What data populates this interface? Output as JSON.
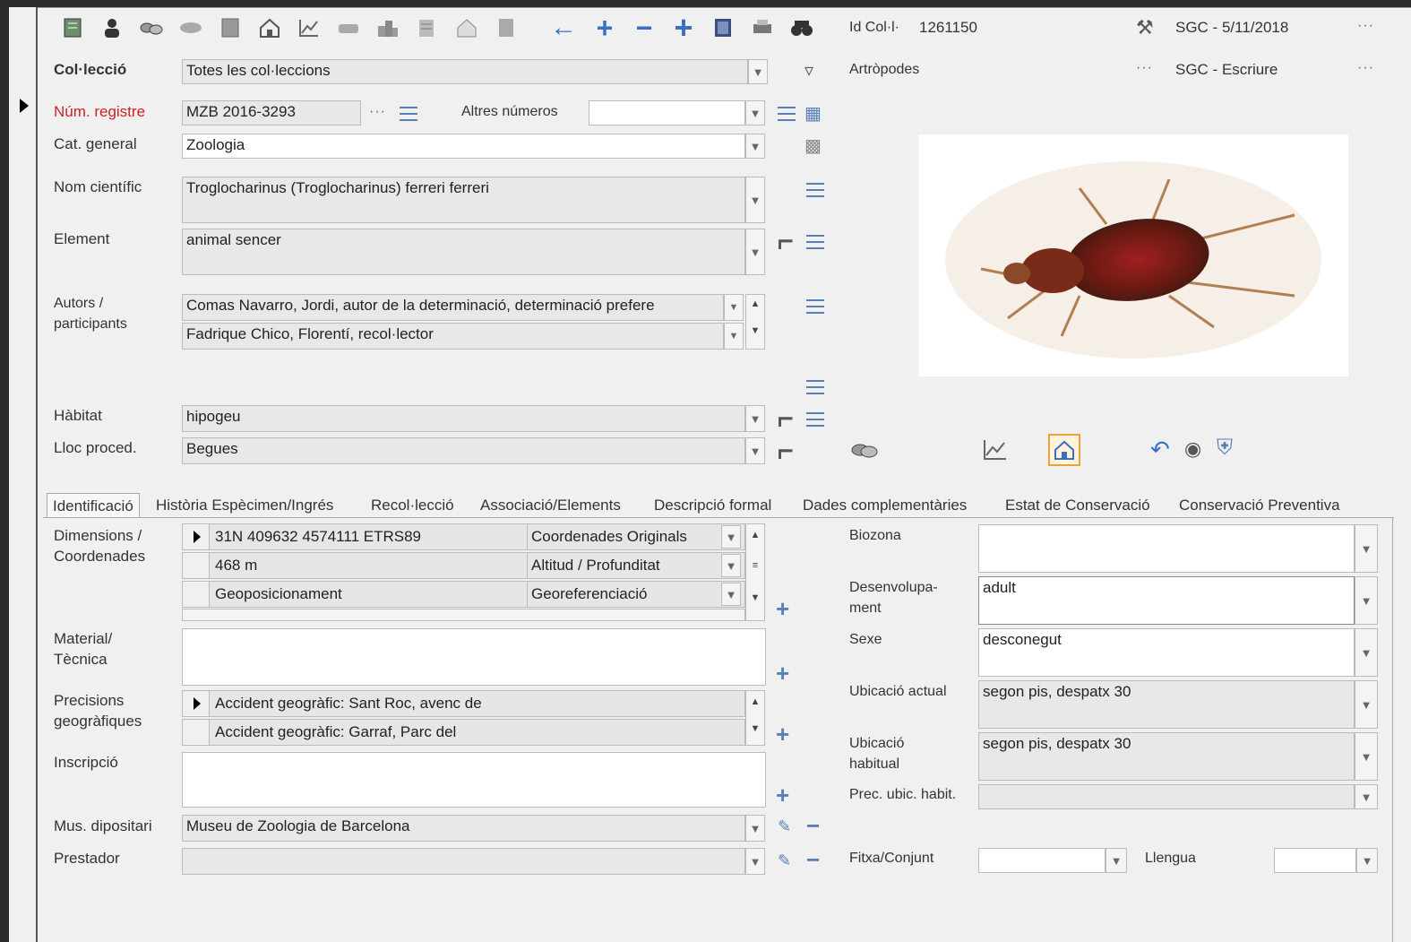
{
  "toolbar": {
    "icons": [
      "ledger-icon",
      "person-icon",
      "shapes-icon",
      "tag-icon",
      "grid-icon",
      "home-icon",
      "chart-icon",
      "vehicle-icon",
      "buildings-icon",
      "map-icon",
      "house-outline-icon",
      "document-icon",
      "arrow-left-icon",
      "plus-icon",
      "minus-icon",
      "add-record-icon",
      "register-icon",
      "print-icon",
      "binoculars-icon"
    ]
  },
  "header": {
    "id_label": "Id Col·l·",
    "id_value": "1261150",
    "sgc_date": "SGC - 5/11/2018",
    "sgc_write": "SGC - Escriure",
    "group": "Artròpodes",
    "more": "···"
  },
  "form": {
    "colleccio_label": "Col·lecció",
    "colleccio_value": "Totes les col·leccions",
    "num_registre_label": "Núm. registre",
    "num_registre_value": "MZB 2016-3293",
    "altres_numeros_label": "Altres números",
    "altres_numeros_value": "",
    "cat_general_label": "Cat. general",
    "cat_general_value": "Zoologia",
    "nom_cientific_label": "Nom científic",
    "nom_cientific_value": "Troglocharinus (Troglocharinus) ferreri ferreri",
    "element_label": "Element",
    "element_value": "animal sencer",
    "autors_label_1": "Autors /",
    "autors_label_2": "participants",
    "autors": [
      "Comas Navarro, Jordi, autor de la determinació, determinació prefere",
      "Fadrique Chico, Florentí, recol·lector"
    ],
    "habitat_label": "Hàbitat",
    "habitat_value": "hipogeu",
    "lloc_label": "Lloc proced.",
    "lloc_value": "Begues"
  },
  "tabs": [
    "Identificació",
    "Història Espècimen/Ingrés",
    "Recol·lecció",
    "Associació/Elements",
    "Descripció formal",
    "Dades complementàries",
    "Estat de Conservació",
    "Conservació Preventiva"
  ],
  "ident": {
    "dimensions_label_1": "Dimensions /",
    "dimensions_label_2": "Coordenades",
    "dimensions": [
      {
        "value": "31N 409632 4574111 ETRS89",
        "type": "Coordenades Originals"
      },
      {
        "value": "468 m",
        "type": "Altitud / Profunditat"
      },
      {
        "value": "Geoposicionament",
        "type": "Georeferenciació"
      }
    ],
    "material_label_1": "Material/",
    "material_label_2": "Tècnica",
    "precisions_label_1": "Precisions",
    "precisions_label_2": "geogràfiques",
    "precisions": [
      "Accident geogràfic: Sant Roc, avenc de",
      "Accident geogràfic: Garraf, Parc del"
    ],
    "inscripcio_label": "Inscripció",
    "museu_label": "Mus. dipositari",
    "museu_value": "Museu de Zoologia de Barcelona",
    "prestador_label": "Prestador",
    "biozona_label": "Biozona",
    "biozona_value": "",
    "desenv_label_1": "Desenvolupa-",
    "desenv_label_2": "ment",
    "desenv_value": "adult",
    "sexe_label": "Sexe",
    "sexe_value": "desconegut",
    "ubic_actual_label": "Ubicació actual",
    "ubic_actual_value": "segon pis, despatx 30",
    "ubic_hab_label_1": "Ubicació",
    "ubic_hab_label_2": "habitual",
    "ubic_hab_value": "segon pis, despatx 30",
    "prec_label": "Prec. ubic. habit.",
    "fitxa_label": "Fitxa/Conjunt",
    "llengua_label": "Llengua"
  },
  "colors": {
    "accent": "#5a7fb5",
    "required": "#d0202a",
    "home": "#e8a33a"
  }
}
